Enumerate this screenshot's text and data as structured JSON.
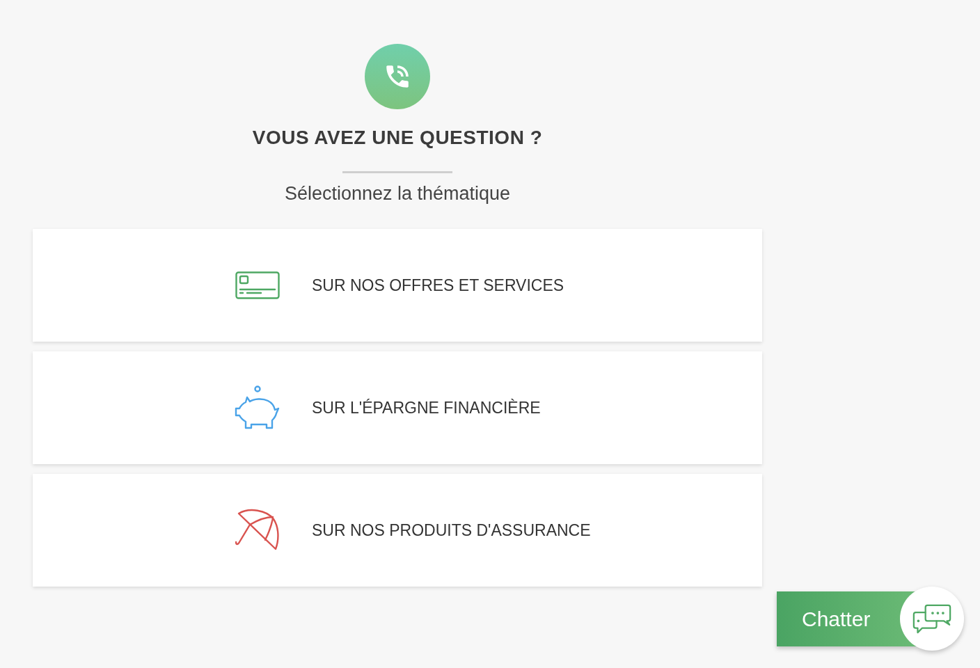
{
  "header": {
    "title": "VOUS AVEZ UNE QUESTION ?",
    "subtitle": "Sélectionnez la thématique"
  },
  "topics": [
    {
      "label": "SUR NOS OFFRES ET SERVICES",
      "kind": "card",
      "color": "#4ea863"
    },
    {
      "label": "SUR L'ÉPARGNE FINANCIÈRE",
      "kind": "piggy",
      "color": "#4aa3e8"
    },
    {
      "label": "SUR NOS PRODUITS D'ASSURANCE",
      "kind": "umbrella",
      "color": "#d9534f"
    }
  ],
  "chat_button": {
    "label": "Chatter"
  }
}
